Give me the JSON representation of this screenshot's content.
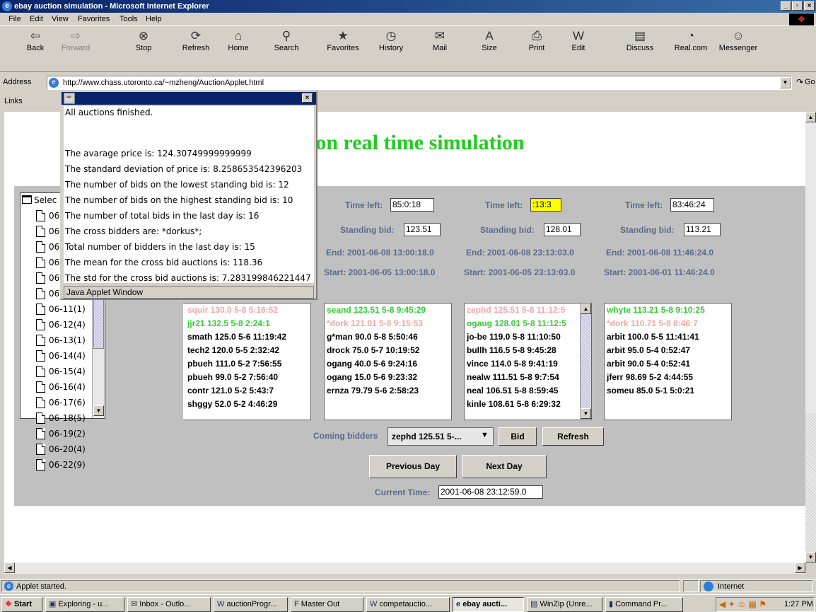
{
  "window": {
    "title": "ebay auction simulation - Microsoft Internet Explorer",
    "min": "_",
    "max": "▫",
    "close": "×"
  },
  "menu": [
    "File",
    "Edit",
    "View",
    "Favorites",
    "Tools",
    "Help"
  ],
  "toolbar": [
    {
      "label": "Back",
      "icon": "⇦"
    },
    {
      "label": "Forward",
      "icon": "⇨"
    },
    {
      "label": "Stop",
      "icon": "⊗"
    },
    {
      "label": "Refresh",
      "icon": "⟳"
    },
    {
      "label": "Home",
      "icon": "⌂"
    },
    {
      "label": "Search",
      "icon": "⚲"
    },
    {
      "label": "Favorites",
      "icon": "★"
    },
    {
      "label": "History",
      "icon": "◷"
    },
    {
      "label": "Mail",
      "icon": "✉"
    },
    {
      "label": "Size",
      "icon": "A"
    },
    {
      "label": "Print",
      "icon": "⎙"
    },
    {
      "label": "Edit",
      "icon": "W"
    },
    {
      "label": "Discuss",
      "icon": "▤"
    },
    {
      "label": "Real.com",
      "icon": "◔"
    },
    {
      "label": "Messenger",
      "icon": "☺"
    }
  ],
  "address": {
    "label": "Address",
    "url": "http://www.chass.utoronto.ca/~mzheng/AuctionApplet.html",
    "go": "Go"
  },
  "links": {
    "label": "Links"
  },
  "page": {
    "heading": "ion real time simulation"
  },
  "tree": {
    "root": "Selec",
    "hidden_items": [
      "06",
      "06",
      "06",
      "06",
      "06",
      "06"
    ],
    "items": [
      "06-11(1)",
      "06-12(4)",
      "06-13(1)",
      "06-14(4)",
      "06-15(4)",
      "06-16(4)",
      "06-17(6)",
      "06-18(5)",
      "06-19(2)",
      "06-20(4)",
      "06-22(9)"
    ]
  },
  "auctions": [
    {
      "time_label": "Time left:",
      "time_left": "85:0:18",
      "standing_label": "Standing bid:",
      "standing_bid": "123.51",
      "end": "End: 2001-06-08 13:00:18.0",
      "start": "Start: 2001-06-05 13:00:18.0",
      "bids": [
        {
          "t": "seand 123.51  5-8 9:45:29",
          "c": "green"
        },
        {
          "t": "*dork 121.01  5-8 9:15:53",
          "c": "pink"
        },
        {
          "t": "g*man 90.0  5-8 5:50:46",
          "c": "black"
        },
        {
          "t": "drock 75.0  5-7 10:19:52",
          "c": "black"
        },
        {
          "t": "ogang 40.0  5-6 9:24:16",
          "c": "black"
        },
        {
          "t": "ogang 15.0  5-6 9:23:32",
          "c": "black"
        },
        {
          "t": "ernza 79.79  5-6 2:58:23",
          "c": "black"
        }
      ]
    },
    {
      "time_label": "Time left:",
      "time_left": ":13:3",
      "standing_label": "Standing bid:",
      "standing_bid": "128.01",
      "end": "End: 2001-06-08 23:13:03.0",
      "start": "Start: 2001-06-05 23:13:03.0",
      "bids": [
        {
          "t": "zephd 125.51  5-8 11:12:5",
          "c": "pink"
        },
        {
          "t": "ogaug 128.01  5-8 11:12:5",
          "c": "green"
        },
        {
          "t": "jo-be 119.0  5-8 11:10:50",
          "c": "black"
        },
        {
          "t": "bullh 116.5  5-8 9:45:28",
          "c": "black"
        },
        {
          "t": "vince 114.0  5-8 9:41:19",
          "c": "black"
        },
        {
          "t": "nealw 111.51  5-8 9:7:54",
          "c": "black"
        },
        {
          "t": "neal 106.51  5-8 8:59:45",
          "c": "black"
        },
        {
          "t": "kinle 108.61  5-8 6:29:32",
          "c": "black"
        }
      ]
    },
    {
      "time_label": "Time left:",
      "time_left": "83:46:24",
      "standing_label": "Standing bid:",
      "standing_bid": "113.21",
      "end": "End: 2001-06-08 11:46:24.0",
      "start": "Start: 2001-06-01 11:46:24.0",
      "bids": [
        {
          "t": "whyte 113.21  5-8 9:10:25",
          "c": "green"
        },
        {
          "t": "*dork 110.71  5-8 8:46:7",
          "c": "pink"
        },
        {
          "t": "arbit 100.0  5-5 11:41:41",
          "c": "black"
        },
        {
          "t": "arbit 95.0  5-4 0:52:47",
          "c": "black"
        },
        {
          "t": "arbit 90.0  5-4 0:52:41",
          "c": "black"
        },
        {
          "t": "jferr 98.69  5-2 4:44:55",
          "c": "black"
        },
        {
          "t": "someu 85.0  5-1 5:0:21",
          "c": "black"
        }
      ]
    }
  ],
  "partial_bids": [
    {
      "t": "squir 130.0  5-8 5:16:52",
      "c": "pink"
    },
    {
      "t": "jjr21 132.5  5-8 2:24:1",
      "c": "green"
    },
    {
      "t": "smath 125.0  5-6 11:19:42",
      "c": "black"
    },
    {
      "t": "tech2 120.0  5-5 2:32:42",
      "c": "black"
    },
    {
      "t": "pbueh 111.0  5-2 7:56:55",
      "c": "black"
    },
    {
      "t": "pbueh 99.0  5-2 7:56:40",
      "c": "black"
    },
    {
      "t": "contr 121.0  5-2 5:43:7",
      "c": "black"
    },
    {
      "t": "shggy 52.0  5-2 4:46:29",
      "c": "black"
    }
  ],
  "controls": {
    "coming_label": "Coming bidders",
    "coming_value": "zephd 125.51  5-...",
    "bid": "Bid",
    "refresh": "Refresh",
    "prev": "Previous Day",
    "next": "Next Day",
    "current_label": "Current Time:",
    "current_time": "2001-06-08 23:12:59.0"
  },
  "popup": {
    "close": "×",
    "lines": [
      "All auctions finished.",
      "",
      "",
      "The avarage price is: 124.30749999999999",
      "The standard deviation of price is: 8.258653542396203",
      "The number of bids on the lowest standing bid is: 12",
      "The number of bids on the highest standing bid is: 10",
      "The number of total bids in the last day is: 16",
      "The cross bidders are:  *dorkus*;",
      "Total number of bidders in the last day is: 15",
      "The mean for the cross bid auctions is: 118.36",
      "The std for the cross bid auctions is: 7.283199846221447"
    ],
    "footer": "Java Applet Window"
  },
  "status": {
    "text": "Applet started.",
    "zone": "Internet"
  },
  "taskbar": {
    "start": "Start",
    "tasks": [
      "Exploring - u...",
      "Inbox - Outlo...",
      "auctionProgr...",
      "Master Out",
      "competauctio...",
      "ebay aucti...",
      "WinZip (Unre...",
      "Command Pr..."
    ],
    "clock": "1:27 PM"
  },
  "colors": {
    "green": "#33cc33",
    "pink": "#f4a6a6",
    "label": "#5a6a8a",
    "highlight": "#ffff00",
    "title": "#0a246a"
  }
}
